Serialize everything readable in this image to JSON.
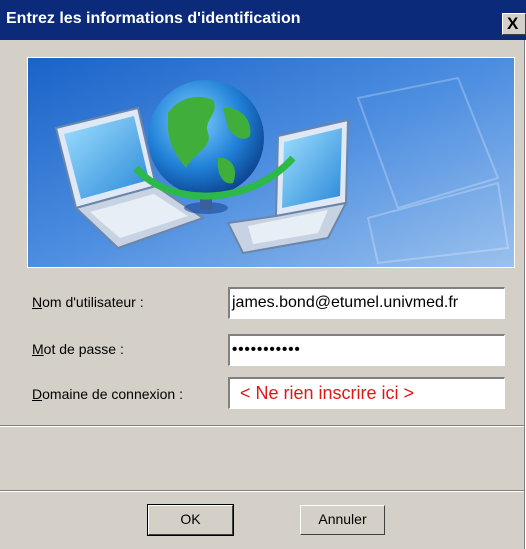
{
  "dialog": {
    "title": "Entrez les informations d'identification",
    "close_glyph": "X"
  },
  "fields": {
    "username": {
      "label_hotkey": "N",
      "label_rest": "om d'utilisateur :",
      "value": "james.bond@etumel.univmed.fr"
    },
    "password": {
      "label_hotkey": "M",
      "label_rest": "ot de passe :",
      "value": "•••••••••••"
    },
    "domain": {
      "label_hotkey": "D",
      "label_rest": "omaine de connexion :",
      "value": "< Ne rien inscrire ici >"
    }
  },
  "buttons": {
    "ok": "OK",
    "cancel": "Annuler"
  },
  "colors": {
    "title_bar": "#0b2a7a",
    "domain_text": "#e01818",
    "dialog_bg": "#d4d0c8"
  },
  "banner_icons": [
    "laptop-left-icon",
    "globe-icon",
    "laptop-right-icon"
  ]
}
